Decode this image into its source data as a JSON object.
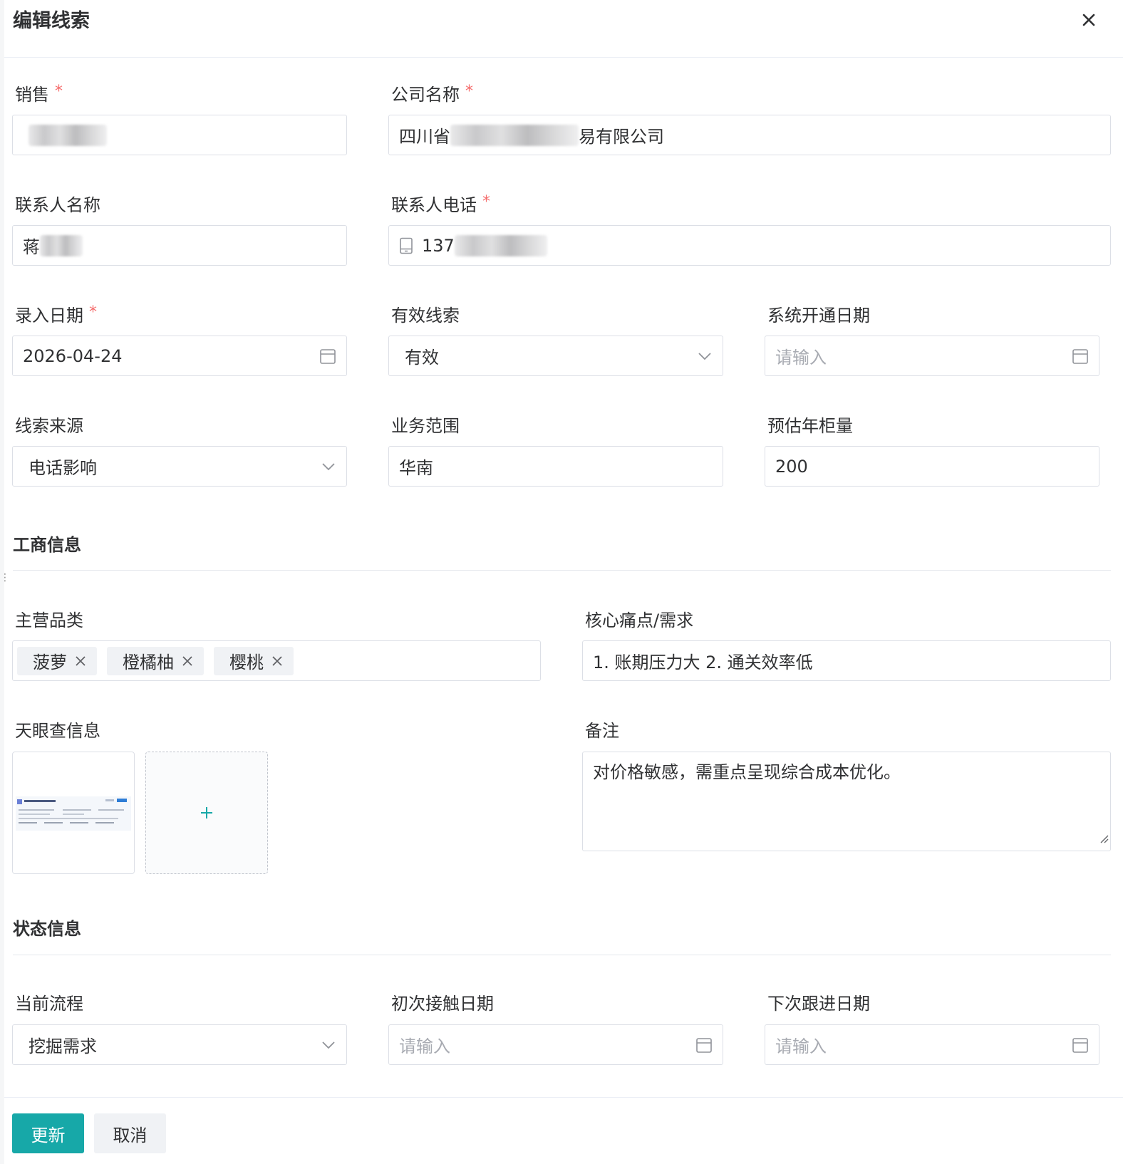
{
  "dialog": {
    "title": "编辑线索",
    "close_icon": "close-icon"
  },
  "accent_color": "#17a8a8",
  "required_color": "#f56c6c",
  "fields": {
    "sales": {
      "label": "销售",
      "required": true
    },
    "company": {
      "label": "公司名称",
      "required": true,
      "value_prefix": "四川省",
      "value_suffix": "易有限公司"
    },
    "contact_name": {
      "label": "联系人名称",
      "value_prefix": "蒋"
    },
    "contact_phone": {
      "label": "联系人电话",
      "required": true,
      "value_prefix": "137",
      "icon": "mobile-icon"
    },
    "entry_date": {
      "label": "录入日期",
      "required": true,
      "value": "2026-04-24"
    },
    "valid_lead": {
      "label": "有效线索",
      "value": "有效"
    },
    "system_open_date": {
      "label": "系统开通日期",
      "placeholder": "请输入"
    },
    "lead_source": {
      "label": "线索来源",
      "value": "电话影响"
    },
    "business_scope": {
      "label": "业务范围",
      "value": "华南"
    },
    "annual_volume": {
      "label": "预估年柜量",
      "value": "200"
    },
    "main_category": {
      "label": "主营品类",
      "tags": [
        "菠萝",
        "橙橘柚",
        "樱桃"
      ]
    },
    "core_pain": {
      "label": "核心痛点/需求",
      "value": "1. 账期压力大 2. 通关效率低"
    },
    "tianyancha": {
      "label": "天眼查信息"
    },
    "remark": {
      "label": "备注",
      "value": "对价格敏感，需重点呈现综合成本优化。"
    },
    "current_process": {
      "label": "当前流程",
      "value": "挖掘需求"
    },
    "first_contact_date": {
      "label": "初次接触日期",
      "placeholder": "请输入"
    },
    "next_follow_date": {
      "label": "下次跟进日期",
      "placeholder": "请输入"
    }
  },
  "sections": {
    "business_info": "工商信息",
    "status_info": "状态信息"
  },
  "buttons": {
    "update": "更新",
    "cancel": "取消"
  }
}
